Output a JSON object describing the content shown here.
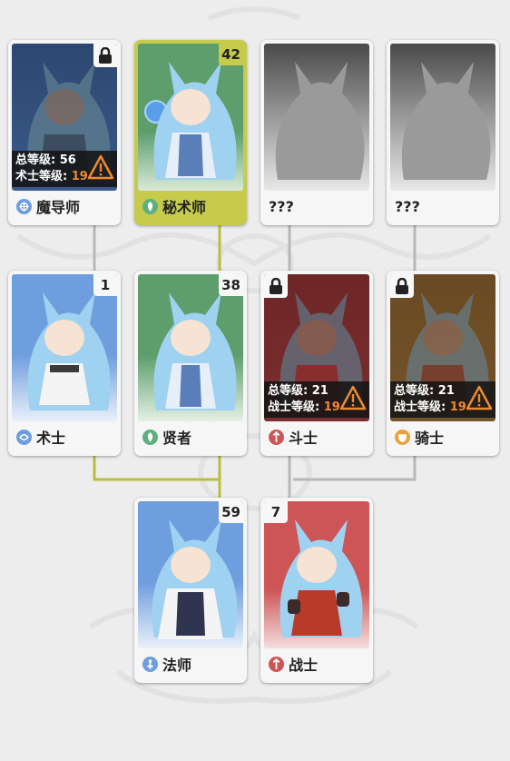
{
  "colors": {
    "mage": "#6f9ede",
    "green": "#5fae7e",
    "warrior": "#cd5555",
    "knight": "#e8a33a",
    "path_active": "#b9bd3f",
    "path_inactive": "#b8b8b8"
  },
  "cards": {
    "moudaoshi": {
      "name": "魔导师",
      "locked": true,
      "req_total_label": "总等级",
      "req_total_value": "56",
      "req_class_label": "术士等级",
      "req_class_value": "19",
      "emblem": "arcane-emblem-icon"
    },
    "mishushi": {
      "name": "秘术师",
      "level": "42",
      "selected": true,
      "emblem": "sage-emblem-icon"
    },
    "unknown1": {
      "name": "???"
    },
    "unknown2": {
      "name": "???"
    },
    "shushi": {
      "name": "术士",
      "level": "1",
      "emblem": "arcane-emblem-icon"
    },
    "xianzhe": {
      "name": "贤者",
      "level": "38",
      "emblem": "sage-emblem-icon"
    },
    "doushi": {
      "name": "斗士",
      "locked": true,
      "req_total_label": "总等级",
      "req_total_value": "21",
      "req_class_label": "战士等级",
      "req_class_value": "19",
      "emblem": "warrior-emblem-icon"
    },
    "qishi": {
      "name": "骑士",
      "locked": true,
      "req_total_label": "总等级",
      "req_total_value": "21",
      "req_class_label": "战士等级",
      "req_class_value": "19",
      "emblem": "knight-emblem-icon"
    },
    "fashi": {
      "name": "法师",
      "level": "59",
      "emblem": "mage-emblem-icon"
    },
    "zhanshi": {
      "name": "战士",
      "level": "7",
      "emblem": "warrior-emblem-icon"
    }
  }
}
